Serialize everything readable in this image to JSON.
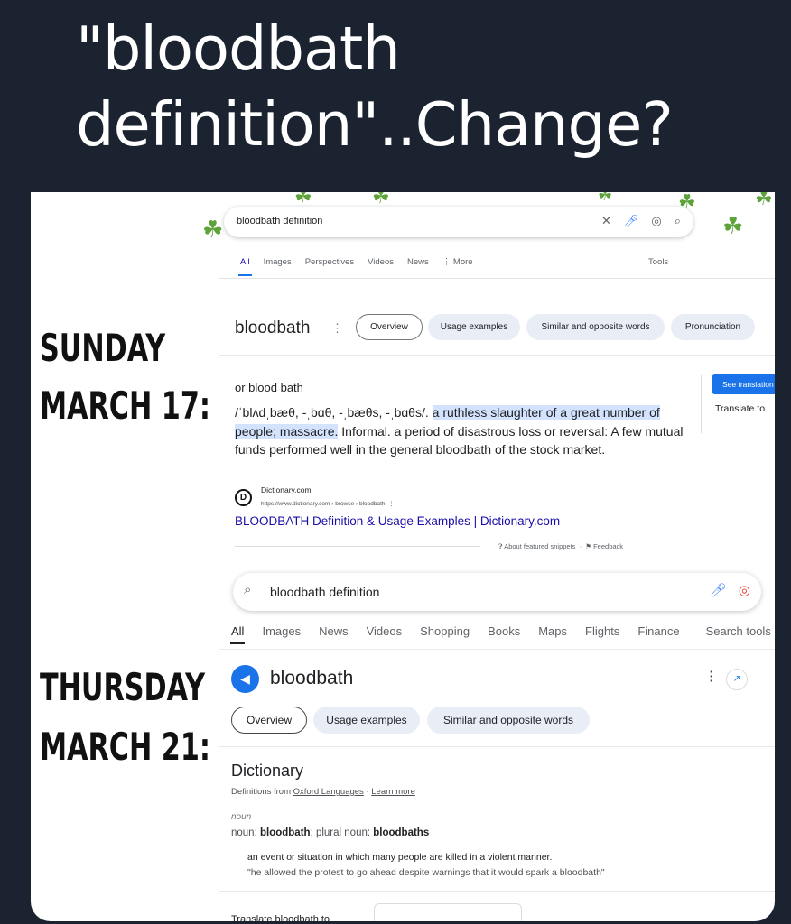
{
  "title": "\"bloodbath definition\"..Change?",
  "labels": {
    "day1_line1": "SUNDAY",
    "day1_line2": "MARCH 17:",
    "day2_line1": "THURSDAY",
    "day2_line2": "MARCH 21:"
  },
  "icons": [
    "clover-icon",
    "close-icon",
    "mic-icon",
    "lens-icon",
    "search-icon",
    "speaker-icon",
    "share-icon",
    "kebab-icon"
  ],
  "colors": {
    "background": "#1b2230",
    "link": "#1a0dab",
    "accent": "#1a73e8",
    "highlight": "#d3e3fd",
    "clover": "#5da23a"
  },
  "shot1": {
    "query": "bloodbath definition",
    "tabs": [
      "All",
      "Images",
      "Perspectives",
      "Videos",
      "News",
      "⋮ More"
    ],
    "tools": "Tools",
    "word": "bloodbath",
    "chips": [
      "Overview",
      "Usage examples",
      "Similar and opposite words",
      "Pronunciation"
    ],
    "alt_spelling": "or blood bath",
    "pronunciation": "/ˈblʌdˌbæθ, -ˌbɑθ, -ˌbæθs, -ˌbɑθs/.",
    "def_highlight": "a ruthless slaughter of a great number of people; massacre.",
    "def_rest": "Informal. a period of disastrous loss or reversal: A few mutual funds performed well in the general bloodbath of the stock market.",
    "see_translation": "See translation",
    "translate_to": "Translate to",
    "source_name": "Dictionary.com",
    "source_url": "https://www.dictionary.com › browse › bloodbath",
    "result_link": "BLOODBATH Definition & Usage Examples | Dictionary.com",
    "about_snippets": "About featured snippets",
    "feedback": "Feedback"
  },
  "shot2": {
    "query": "bloodbath definition",
    "tabs": [
      "All",
      "Images",
      "News",
      "Videos",
      "Shopping",
      "Books",
      "Maps",
      "Flights",
      "Finance"
    ],
    "search_tools": "Search tools",
    "word": "bloodbath",
    "chips": [
      "Overview",
      "Usage examples",
      "Similar and opposite words"
    ],
    "dictionary": "Dictionary",
    "definitions_from": "Definitions from",
    "oxford": "Oxford Languages",
    "learn_more": "Learn more",
    "pos": "noun",
    "forms_prefix": "noun:",
    "forms_word": "bloodbath",
    "forms_plural_label": "; plural noun:",
    "forms_plural": "bloodbaths",
    "sense": "an event or situation in which many people are killed in a violent manner.",
    "example": "\"he allowed the protest to go ahead despite warnings that it would spark a bloodbath\"",
    "translate_cut": "Translate bloodbath to"
  }
}
